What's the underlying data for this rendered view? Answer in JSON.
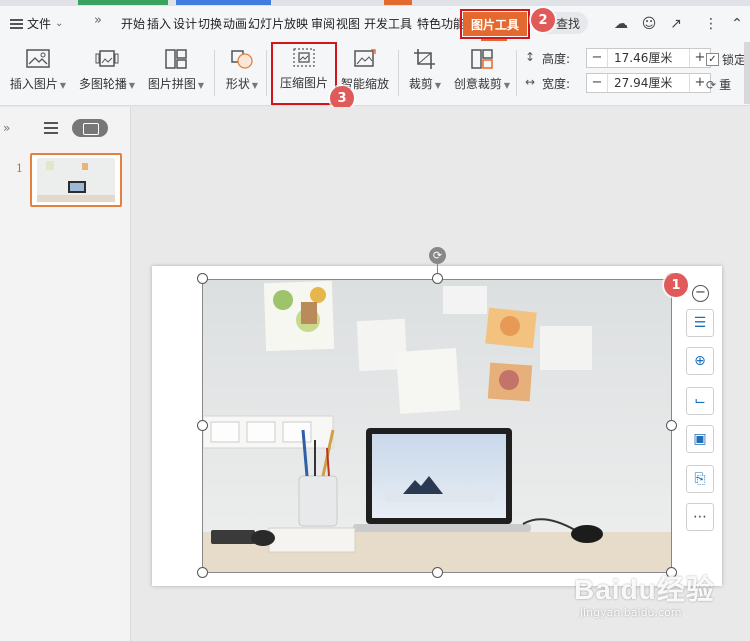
{
  "menubar": {
    "file_label": "文件",
    "tabs": [
      "开始",
      "插入",
      "设计",
      "切换",
      "动画",
      "幻灯片放映",
      "审阅",
      "视图",
      "开发工具",
      "特色功能"
    ],
    "active_tab": "图片工具",
    "search_label": "查找"
  },
  "ribbon": {
    "buttons": [
      {
        "label": "插入图片",
        "icon": "insert-picture-icon"
      },
      {
        "label": "多图轮播",
        "icon": "carousel-icon"
      },
      {
        "label": "图片拼图",
        "icon": "collage-icon"
      },
      {
        "label": "形状",
        "icon": "shape-icon"
      },
      {
        "label": "压缩图片",
        "icon": "compress-picture-icon"
      },
      {
        "label": "智能缩放",
        "icon": "smart-scale-icon"
      },
      {
        "label": "裁剪",
        "icon": "crop-icon"
      },
      {
        "label": "创意裁剪",
        "icon": "creative-crop-icon"
      }
    ],
    "height_label": "高度:",
    "height_value": "17.46厘米",
    "width_label": "宽度:",
    "width_value": "27.94厘米",
    "lock_label": "锁定",
    "reset_label": "重"
  },
  "annotations": {
    "badge1": "1",
    "badge2": "2",
    "badge3": "3"
  },
  "slides_panel": {
    "slide_number": "1"
  },
  "watermark": {
    "main": "Baidu经验",
    "sub": "jingyan.baidu.com"
  },
  "colors": {
    "accent_orange": "#e4692f",
    "highlight_red": "#d0161a",
    "badge_red": "#e05a5a",
    "tool_blue": "#1e6fba"
  }
}
